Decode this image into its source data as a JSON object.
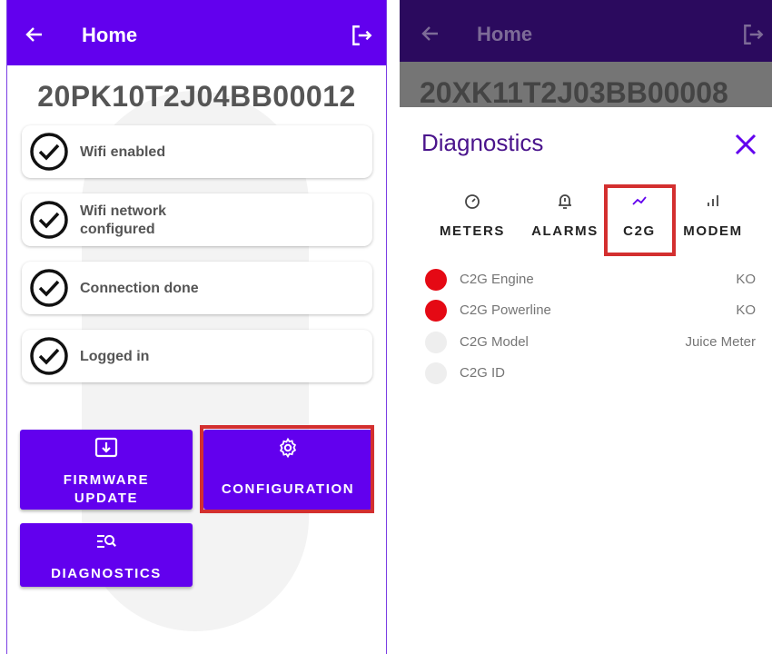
{
  "left": {
    "appbar": {
      "title": "Home",
      "back_icon": "arrow-left-icon",
      "logout_icon": "logout-icon"
    },
    "serial": "20PK10T2J04BB00012",
    "steps": [
      {
        "label": "Wifi enabled"
      },
      {
        "label": "Wifi network configured"
      },
      {
        "label": "Connection done"
      },
      {
        "label": "Logged in"
      }
    ],
    "buttons": {
      "firmware_line1": "FIRMWARE",
      "firmware_line2": "UPDATE",
      "configuration": "CONFIGURATION",
      "diagnostics": "DIAGNOSTICS"
    }
  },
  "right": {
    "appbar": {
      "title": "Home"
    },
    "serial": "20XK11T2J03BB00008",
    "dialog": {
      "title": "Diagnostics",
      "tabs": [
        {
          "label": "METERS",
          "icon": "gauge-icon"
        },
        {
          "label": "ALARMS",
          "icon": "alarm-bell-icon"
        },
        {
          "label": "C2G",
          "icon": "trend-icon",
          "selected": true
        },
        {
          "label": "MODEM",
          "icon": "signal-bars-icon"
        }
      ],
      "rows": [
        {
          "name": "C2G Engine",
          "value": "KO",
          "status_color": "#e50914"
        },
        {
          "name": "C2G Powerline",
          "value": "KO",
          "status_color": "#e50914"
        },
        {
          "name": "C2G Model",
          "value": "Juice Meter",
          "status_color": "#eeeeee"
        },
        {
          "name": "C2G ID",
          "value": "",
          "status_color": "#eeeeee"
        }
      ]
    }
  },
  "colors": {
    "primary": "#6200ee",
    "highlight": "#d32f2f",
    "error": "#e50914"
  }
}
